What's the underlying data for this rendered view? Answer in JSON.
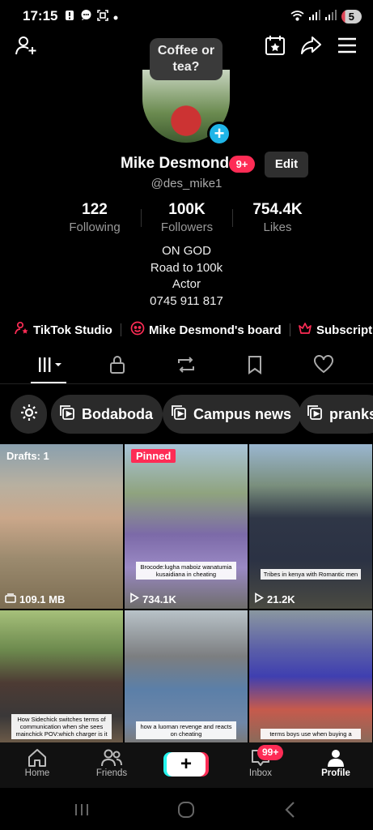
{
  "status": {
    "time": "17:15",
    "battery": "5"
  },
  "profile": {
    "tooltip": "Coffee or\ntea?",
    "name": "Mike Desmond",
    "badge": "9+",
    "edit_label": "Edit",
    "handle": "@des_mike1",
    "stats": [
      {
        "value": "122",
        "label": "Following"
      },
      {
        "value": "100K",
        "label": "Followers"
      },
      {
        "value": "754.4K",
        "label": "Likes"
      }
    ],
    "bio": [
      "ON GOD",
      "Road to 100k",
      "Actor",
      "0745 911 817"
    ]
  },
  "links": [
    {
      "label": "TikTok Studio",
      "icon": "person-star-icon"
    },
    {
      "label": "Mike Desmond's board",
      "icon": "board-icon"
    },
    {
      "label": "Subscript",
      "icon": "crown-icon"
    }
  ],
  "tabs": [
    "grid-icon",
    "lock-icon",
    "repost-icon",
    "bookmark-icon",
    "heart-icon"
  ],
  "chips": [
    "Bodaboda",
    "Campus news",
    "pranks"
  ],
  "videos": [
    {
      "tag": "Drafts: 1",
      "caption": "",
      "count": "109.1 MB",
      "count_icon": "drafts-icon"
    },
    {
      "tag": "Pinned",
      "caption": "Brocode:lugha maboiz wanatumia kusaidiana in cheating",
      "count": "734.1K",
      "count_icon": "play-icon"
    },
    {
      "tag": "",
      "caption": "Tribes in kenya with Romantic men",
      "count": "21.2K",
      "count_icon": "play-icon"
    },
    {
      "tag": "",
      "caption": "How Sidechick switches terms of communication when she sees mainchick POV:which charger is it",
      "count": "",
      "count_icon": ""
    },
    {
      "tag": "",
      "caption": "how a luoman revenge and reacts on cheating",
      "count": "",
      "count_icon": ""
    },
    {
      "tag": "",
      "caption": "terms boys use when buying a",
      "count": "",
      "count_icon": ""
    }
  ],
  "nav": {
    "home": "Home",
    "friends": "Friends",
    "inbox": "Inbox",
    "inbox_badge": "99+",
    "profile": "Profile"
  },
  "colors": {
    "accent": "#fe2c55",
    "cyan": "#25f4ee",
    "plus": "#1fb5e8"
  }
}
